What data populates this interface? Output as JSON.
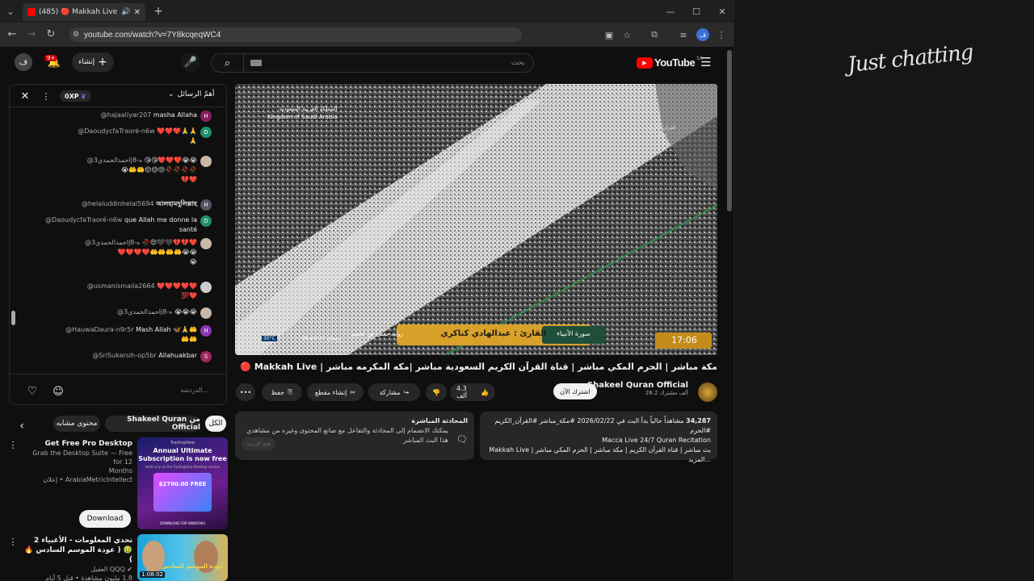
{
  "browser": {
    "tab_title": "(485) 🔴 Makkah Live | الحرم المكي",
    "new_tab": "+",
    "url": "youtube.com/watch?v=7Y8kcqeqWC4"
  },
  "youtube": {
    "logo": "YouTube",
    "region": "SA",
    "search_placeholder": "بحث",
    "create_label": "إنشاء",
    "notif_count": "9+",
    "avatar_letter": "ف"
  },
  "chat": {
    "header_label": "أهمّ الرسائل",
    "xp": "0XP",
    "input_placeholder": "الدردشة...",
    "messages": [
      {
        "author": "@hajaaliyar207",
        "text": "masha Allaha",
        "letter": "H",
        "color": "#8a1d5f"
      },
      {
        "author": "@DaoudycfaTraoré-n6w",
        "text": "❤️❤️❤️🙏🙏",
        "text2": "🙏",
        "letter": "D",
        "color": "#1f8f6b"
      },
      {
        "author": "@احمدالحمدي3j8-ه",
        "text": "😘😘❤️❤️❤️😭😭",
        "text2": "😭🤲🤲😔😔😔🥀🥀🥀🥀",
        "text3": "💔❤️",
        "letter": "",
        "color": "#c9b7a8"
      },
      {
        "author": "@helaluddinhelal5694",
        "text": "আলহামদুলিল্লাহ",
        "letter": "H",
        "color": "#556"
      },
      {
        "author": "@DaoudycfaTraoré-n6w",
        "text": "que Allah me donne la",
        "text2": "santé",
        "letter": "D",
        "color": "#1f8f6b"
      },
      {
        "author": "@احمدالحمدي3j8-ه",
        "text": "🥀😔🖤🖤💔💔❤️",
        "text2": "❤️❤️❤️❤️🤲🤲🤲🤲😭😭",
        "text3": "😭",
        "letter": "",
        "color": "#c9b7a8"
      },
      {
        "author": "@usmanismaila2664",
        "text": "❤️❤️❤️❤️❤️",
        "text2": "💯❤️",
        "letter": "",
        "color": "#ccc"
      },
      {
        "author": "@احمدالحمدي3j8-ه",
        "text": "😭😭😭",
        "letter": "",
        "color": "#c9b7a8"
      },
      {
        "author": "@HauwaDaura-n9r5r",
        "text": "Mash Allah 🦋🙏🤲",
        "text2": "🤲🤲",
        "letter": "H",
        "color": "#8a38b0"
      },
      {
        "author": "@SriSukarsih-op5br",
        "text": "Allahuakbar",
        "letter": "S",
        "color": "#a0275f"
      }
    ]
  },
  "video": {
    "overlay_sa_ar": "المملكة العربية السعودية",
    "overlay_sa_en": "Kingdom of Saudi Arabia",
    "reciter": "القارئ : عبدالهادي كناكري",
    "surah": "سورة الأنبياء",
    "narration": "رواية حفص عن عاصم",
    "time": "17:06",
    "temp": "30°C",
    "date_small": "09 رمضان 1447هـ",
    "corner_text": "القرآن الكريم",
    "corner_text2": "Live",
    "title": "مكة مباشر | الحرم المكي مباشر | قناة القرآن الكريم السعودية مباشر |مكه المكرمه مباشر | Makkah Live 🔴"
  },
  "channel": {
    "name": "Shakeel Quran Official",
    "subs": "26.2 ألف مشترك",
    "subscribe_label": "اشترك الآن"
  },
  "actions": {
    "likes": "4.3 ألف",
    "share": "مشاركة",
    "clip": "إنشاء مقطع",
    "save": "حفظ",
    "more": "•••"
  },
  "description": {
    "views": "34,287",
    "line1": "مشاهداً حالياً  بدأ البث في 2026/02/22  #مكة_مباشر #القرآن_الكريم #الحرم",
    "line2": "Macca Live 24/7 Quran Recitation",
    "line3": "بث مباشر | قناة القرآن الكريم  |  مكة مباشر | الحرم المكي مباشر | Makkah Live ...المزيد"
  },
  "live_chat_box": {
    "title": "المحادثة المباشرة",
    "text": "يمكنك الانضمام إلى المحادثة والتفاعل مع صانع المحتوى وغيره من مشاهدي هذا البث المباشر",
    "button": "فتح الزمنة"
  },
  "chips": {
    "all": "الكل",
    "from": "من Shakeel Quran Official",
    "related": "محتوى مشابه"
  },
  "recs": [
    {
      "title": "Get Free Pro Desktop",
      "line1": "Grab the Desktop Suite — Free for 12",
      "line2": "Months",
      "channel": "ArabiaMetricIntellect • إعلان",
      "thumb_top": "TradingView",
      "thumb_line1": "Annual Ultimate",
      "thumb_line2": "Subscription is now free",
      "thumb_sub": "Valid only on the TradingView Desktop version",
      "thumb_free": "$2700.00 FREE",
      "thumb_bottom": "DOWNLOAD FOR WINDOWS",
      "download": "Download"
    },
    {
      "title": "تحدي المعلومات - الأغبياء 2 🤢 ( عودة الموسم السادس 🔥 )",
      "channel": "العقيل QQQ ✔",
      "meta": "1.8 مليون مشاهدة • قبل 5 أيام",
      "duration": "1:08:02",
      "thumb_text": "عودة الموسم السادس"
    }
  ],
  "overlay": {
    "text": "Just chatting"
  },
  "colors": {
    "accent_red": "#ff0000",
    "bg": "#0f0f0f",
    "chip_bg": "#272727"
  }
}
